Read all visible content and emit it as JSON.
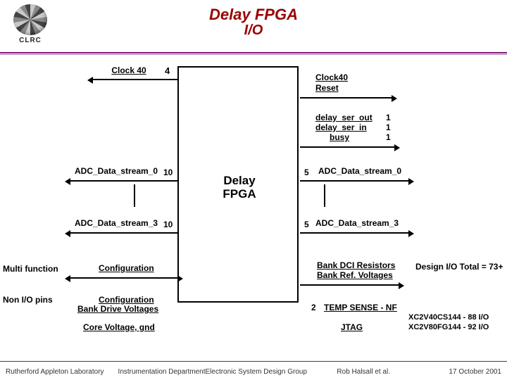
{
  "header": {
    "title": "Delay FPGA",
    "subtitle": "I/O",
    "logo_text": "CLRC"
  },
  "center": {
    "label_line1": "Delay",
    "label_line2": "FPGA"
  },
  "left": {
    "clock40": "Clock 40",
    "bus4": "4",
    "adc0": "ADC_Data_stream_0",
    "bus10a": "10",
    "adc3": "ADC_Data_stream_3",
    "bus10b": "10",
    "multi_function": "Multi function",
    "configuration": "Configuration",
    "non_io_pins": "Non I/O pins",
    "configuration2": "Configuration",
    "bank_drive": "Bank Drive Voltages",
    "core_v": "Core Voltage, gnd"
  },
  "right": {
    "clock40": "Clock40",
    "reset": "Reset",
    "delay_ser_out": "delay_ser_out",
    "delay_ser_in": "delay_ser_in",
    "busy": "busy",
    "one_a": "1",
    "one_b": "1",
    "one_c": "1",
    "adc0": "ADC_Data_stream_0",
    "bus5a": "5",
    "adc3": "ADC_Data_stream_3",
    "bus5b": "5",
    "bank_dci": "Bank DCI Resistors",
    "bank_ref": "Bank Ref. Voltages",
    "design_total": "Design I/O Total = 73+",
    "two": "2",
    "temp_sense": "TEMP SENSE - NF",
    "jtag": "JTAG",
    "part1": "XC2V40CS144 - 88 I/O",
    "part2": "XC2V80FG144 - 92 I/O"
  },
  "footer": {
    "c1": "Rutherford Appleton Laboratory",
    "c2": "Instrumentation Department",
    "c3": "Electronic System Design Group",
    "c4": "Rob Halsall et al.",
    "c5": "17 October 2001"
  }
}
